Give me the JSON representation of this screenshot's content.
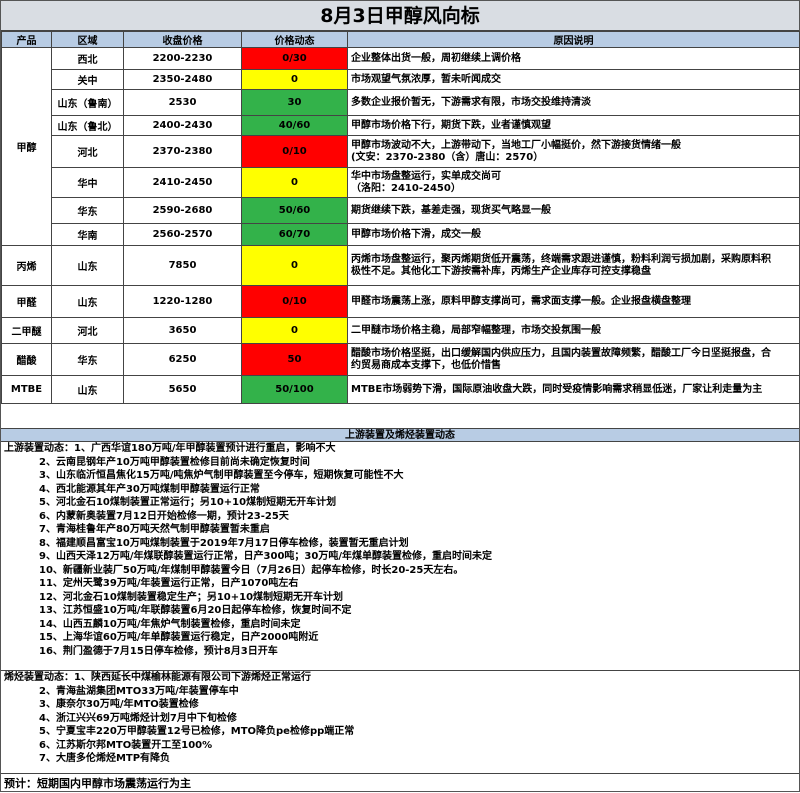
{
  "title": "8月3日甲醇风向标",
  "headers": [
    "产品",
    "区域",
    "收盘价格",
    "价格动态",
    "原因说明"
  ],
  "groups": [
    {
      "product": "甲醇",
      "rows": [
        {
          "region": "西北",
          "price": "2200-2230",
          "change": "0/30",
          "color": "red",
          "reason": [
            "企业整体出货一般，周初继续上调价格"
          ]
        },
        {
          "region": "关中",
          "price": "2350-2480",
          "change": "0",
          "color": "yel",
          "reason": [
            "市场观望气氛浓厚，暂未听闻成交"
          ]
        },
        {
          "region": "山东（鲁南）",
          "price": "2530",
          "change": "30",
          "color": "grn",
          "reason": [
            "多数企业报价暂无，下游需求有限，市场交投维持清淡"
          ]
        },
        {
          "region": "山东（鲁北）",
          "price": "2400-2430",
          "change": "40/60",
          "color": "grn",
          "reason": [
            "甲醇市场价格下行，期货下跌，业者谨慎观望"
          ]
        },
        {
          "region": "河北",
          "price": "2370-2380",
          "change": "0/10",
          "color": "red",
          "reason": [
            "甲醇市场波动不大，上游带动下，当地工厂小幅挺价，然下游接货情绪一般",
            "(文安：2370-2380（含）唐山：2570）"
          ]
        },
        {
          "region": "华中",
          "price": "2410-2450",
          "change": "0",
          "color": "yel",
          "reason": [
            "华中市场盘整运行，实单成交尚可",
            "（洛阳：2410-2450）"
          ]
        },
        {
          "region": "华东",
          "price": "2590-2680",
          "change": "50/60",
          "color": "grn",
          "reason": [
            "期货继续下跌，基差走强，现货买气略显一般"
          ]
        },
        {
          "region": "华南",
          "price": "2560-2570",
          "change": "60/70",
          "color": "grn",
          "reason": [
            "甲醇市场价格下滑，成交一般"
          ]
        }
      ]
    },
    {
      "product": "丙烯",
      "rows": [
        {
          "region": "山东",
          "price": "7850",
          "change": "0",
          "color": "yel",
          "reason": [
            "丙烯市场盘整运行，聚丙烯期货低开震荡，终端需求跟进谨慎，粉料利润亏损加剧，采购原料积",
            "极性不足。其他化工下游按需补库，丙烯生产企业库存可控支撑稳盘"
          ]
        }
      ]
    },
    {
      "product": "甲醛",
      "rows": [
        {
          "region": "山东",
          "price": "1220-1280",
          "change": "0/10",
          "color": "red",
          "reason": [
            "甲醛市场震荡上涨，原料甲醇支撑尚可，需求面支撑一般。企业报盘横盘整理"
          ]
        }
      ]
    },
    {
      "product": "二甲醚",
      "rows": [
        {
          "region": "河北",
          "price": "3650",
          "change": "0",
          "color": "yel",
          "reason": [
            "二甲醚市场价格主稳，局部窄幅整理，市场交投氛围一般"
          ]
        }
      ]
    },
    {
      "product": "醋酸",
      "rows": [
        {
          "region": "华东",
          "price": "6250",
          "change": "50",
          "color": "red",
          "reason": [
            "醋酸市场价格坚挺，出口缓解国内供应压力，且国内装置故障频繁，醋酸工厂今日坚挺报盘，合",
            "约贸易商成本支撑下，也低价惜售"
          ]
        }
      ]
    },
    {
      "product": "MTBE",
      "rows": [
        {
          "region": "山东",
          "price": "5650",
          "change": "50/100",
          "color": "grn",
          "reason": [
            "MTBE市场弱势下滑，国际原油收盘大跌，同时受疫情影响需求稍显低迷，厂家让利走量为主"
          ]
        }
      ]
    }
  ],
  "section_title": "上游装置及烯烃装置动态",
  "upstream": {
    "head": "上游装置动态：1、广西华谊180万吨/年甲醇装置预计进行重启，影响不大",
    "items": [
      "2、云南昆钢年产10万吨甲醇装置检修目前尚未确定恢复时间",
      "3、山东临沂恒昌焦化15万吨/吨焦炉气制甲醇装置至今停车，短期恢复可能性不大",
      "4、西北能源其年产30万吨煤制甲醇装置运行正常",
      "5、河北金石10煤制装置正常运行；另10+10煤制短期无开车计划",
      "6、内蒙新奥装置7月12日开始检修一期，预计23-25天",
      "7、青海桂鲁年产80万吨天然气制甲醇装置暂未重启",
      "8、福建顺昌富宝10万吨煤制装置于2019年7月17日停车检修，装置暂无重启计划",
      "9、山西天泽12万吨/年煤联醇装置运行正常，日产300吨；30万吨/年煤单醇装置检修，重启时间未定",
      "10、新疆新业装厂50万吨/年煤制甲醇装置今日（7月26日）起停车检修，时长20-25天左右。",
      "11、定州天鹭39万吨/年装置运行正常，日产1070吨左右",
      "12、河北金石10煤制装置稳定生产；另10+10煤制短期无开车计划",
      "13、江苏恒盛10万吨/年联醇装置6月20日起停车检修，恢复时间不定",
      "14、山西五麟10万吨/年焦炉气制装置检修，重启时间未定",
      "15、上海华谊60万吨/年单醇装置运行稳定，日产2000吨附近",
      "16、荆门盈德于7月15日停车检修，预计8月3日开车"
    ]
  },
  "olefin": {
    "head": "烯烃装置动态：1、陕西延长中煤榆林能源有限公司下游烯烃正常运行",
    "items": [
      "2、青海盐湖集团MTO33万吨/年装置停车中",
      "3、康奈尔30万吨/年MTO装置检修",
      "4、浙江兴兴69万吨烯烃计划7月中下旬检修",
      "5、宁夏宝丰220万甲醇装置12号已检修，MTO降负pe检修pp端正常",
      "6、江苏斯尔邦MTO装置开工至100%",
      "7、大唐多伦烯烃MTP有降负"
    ]
  },
  "forecast": "预计：短期国内甲醇市场震荡运行为主"
}
